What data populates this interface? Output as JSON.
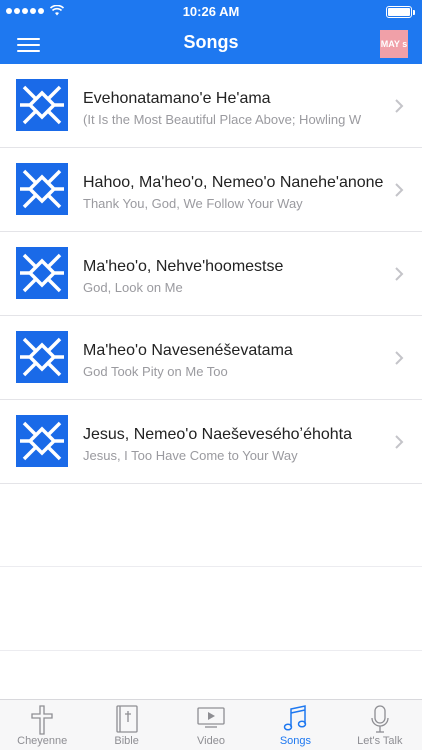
{
  "status_bar": {
    "time": "10:26 AM",
    "signal_dots": 5,
    "battery_level": 1.0
  },
  "nav": {
    "title": "Songs",
    "badge_text": "MAY s",
    "menu_icon": "hamburger-menu-icon"
  },
  "colors": {
    "accent": "#1e78f0",
    "thumbnail": "#1a6ae8",
    "badge": "#f0a0a8"
  },
  "songs": [
    {
      "title": "Evehonatamano'e He'ama",
      "subtitle": "(It Is the Most Beautiful Place Above; Howling W"
    },
    {
      "title": "Hahoo, Ma'heo'o, Nemeo'o Nanehe'anone",
      "subtitle": "Thank You, God, We Follow Your Way"
    },
    {
      "title": "Ma'heo'o, Nehve'hoomestse",
      "subtitle": "God, Look on Me"
    },
    {
      "title": "Ma'heo'o Navesenéševatama",
      "subtitle": "God Took Pity on Me Too"
    },
    {
      "title": "Jesus, Nemeo'o Naeševeséhoʼéhohta",
      "subtitle": "Jesus, I Too Have Come to Your Way"
    }
  ],
  "tabs": [
    {
      "label": "Cheyenne",
      "icon": "cross-icon",
      "active": false
    },
    {
      "label": "Bible",
      "icon": "bible-icon",
      "active": false
    },
    {
      "label": "Video",
      "icon": "video-play-icon",
      "active": false
    },
    {
      "label": "Songs",
      "icon": "music-note-icon",
      "active": true
    },
    {
      "label": "Let's Talk",
      "icon": "microphone-icon",
      "active": false
    }
  ]
}
